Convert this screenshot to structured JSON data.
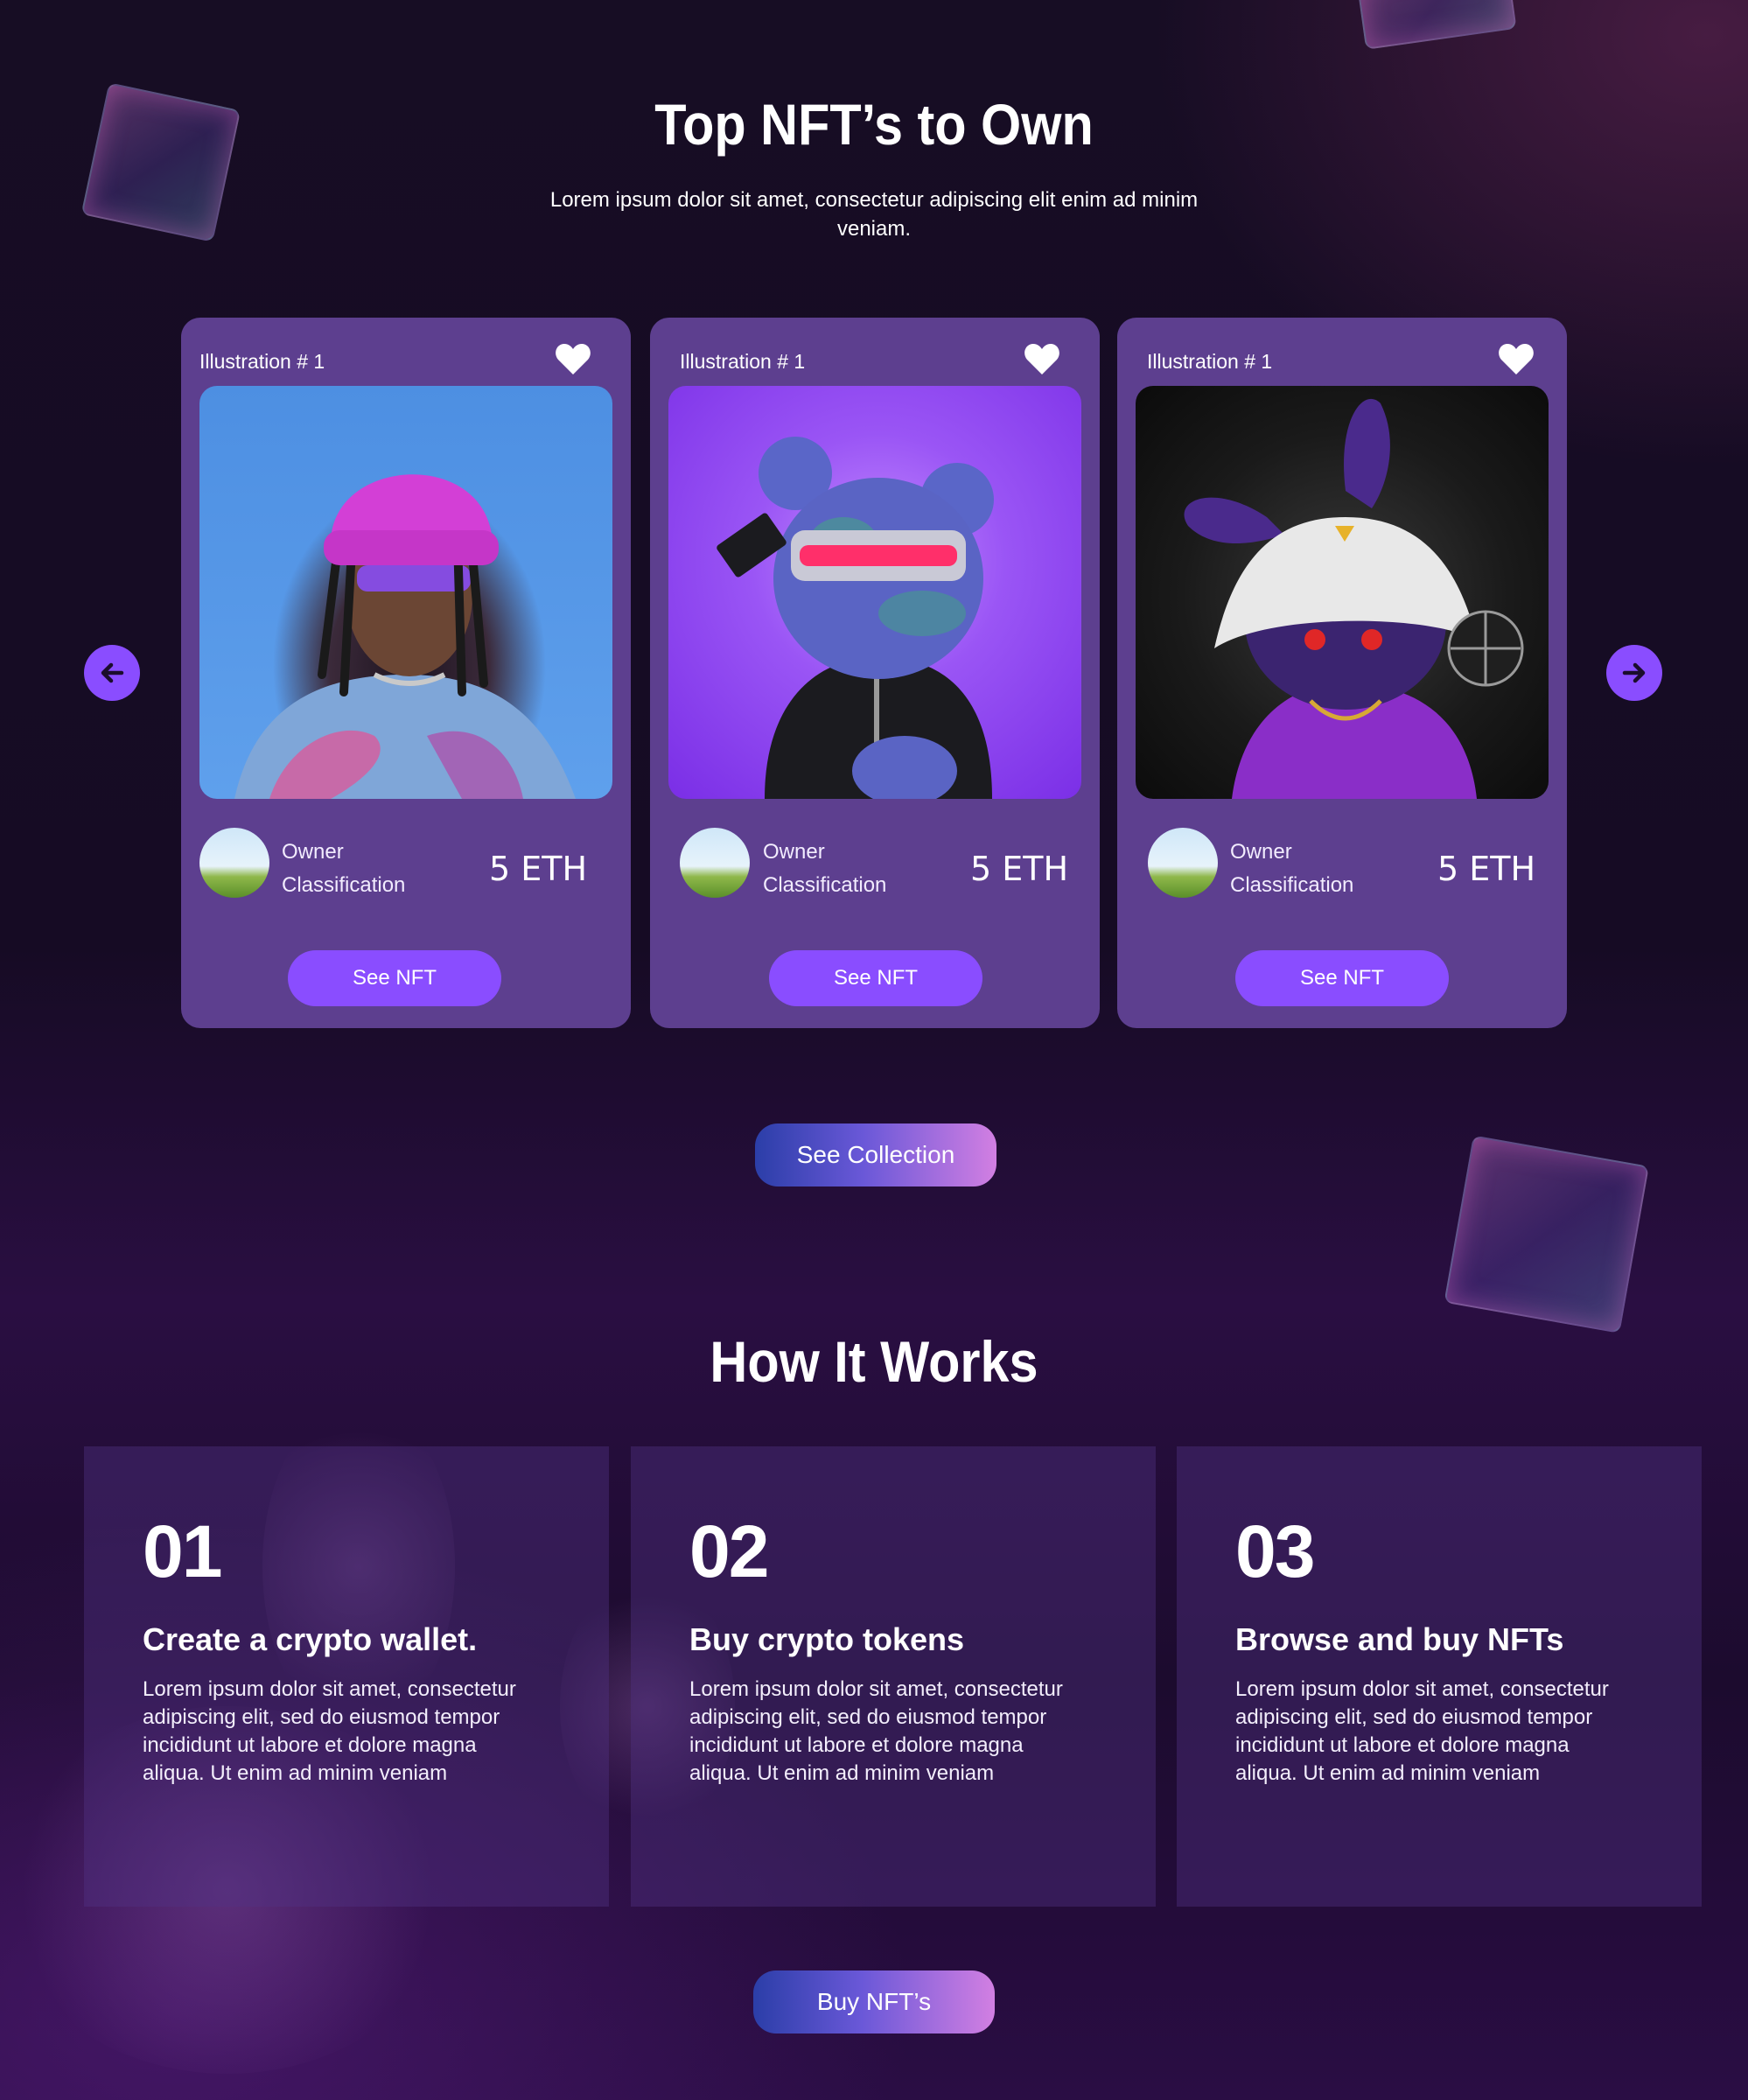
{
  "top_nfts": {
    "title": "Top NFT’s to Own",
    "subtitle": "Lorem ipsum dolor sit amet, consectetur adipiscing elit enim ad minim veniam."
  },
  "cards": [
    {
      "label": "Illustration # 1",
      "owner": "Owner",
      "classification": "Classification",
      "price": "5 ETH",
      "button": "See NFT",
      "image": "nft-girl-pink-beanie"
    },
    {
      "label": "Illustration # 1",
      "owner": "Owner",
      "classification": "Classification",
      "price": "5 ETH",
      "button": "See NFT",
      "image": "nft-cyber-bear"
    },
    {
      "label": "Illustration # 1",
      "owner": "Owner",
      "classification": "Classification",
      "price": "5 ETH",
      "button": "See NFT",
      "image": "nft-rabbit-bucket-hat"
    }
  ],
  "see_collection": "See Collection",
  "how_it_works": {
    "title": "How It Works",
    "steps": [
      {
        "num": "01",
        "title": "Create a crypto wallet.",
        "text": "Lorem ipsum dolor sit amet, consectetur adipiscing elit, sed do eiusmod tempor incididunt ut labore et dolore magna aliqua. Ut enim ad minim veniam"
      },
      {
        "num": "02",
        "title": "Buy crypto tokens",
        "text": "Lorem ipsum dolor sit amet, consectetur adipiscing elit, sed do eiusmod tempor incididunt ut labore et dolore magna aliqua. Ut enim ad minim veniam"
      },
      {
        "num": "03",
        "title": "Browse and buy NFTs",
        "text": "Lorem ipsum dolor sit amet, consectetur adipiscing elit, sed do eiusmod tempor incididunt ut labore et dolore magna aliqua. Ut enim ad minim veniam"
      }
    ]
  },
  "buy_nfts": "Buy NFT’s",
  "colors": {
    "card_bg": "#5d3f8f",
    "accent": "#8a4dff",
    "gradient_start": "#2b3ea8",
    "gradient_end": "#d27fe2"
  },
  "icons": {
    "prev": "arrow-left-icon",
    "next": "arrow-right-icon",
    "like": "heart-icon"
  }
}
